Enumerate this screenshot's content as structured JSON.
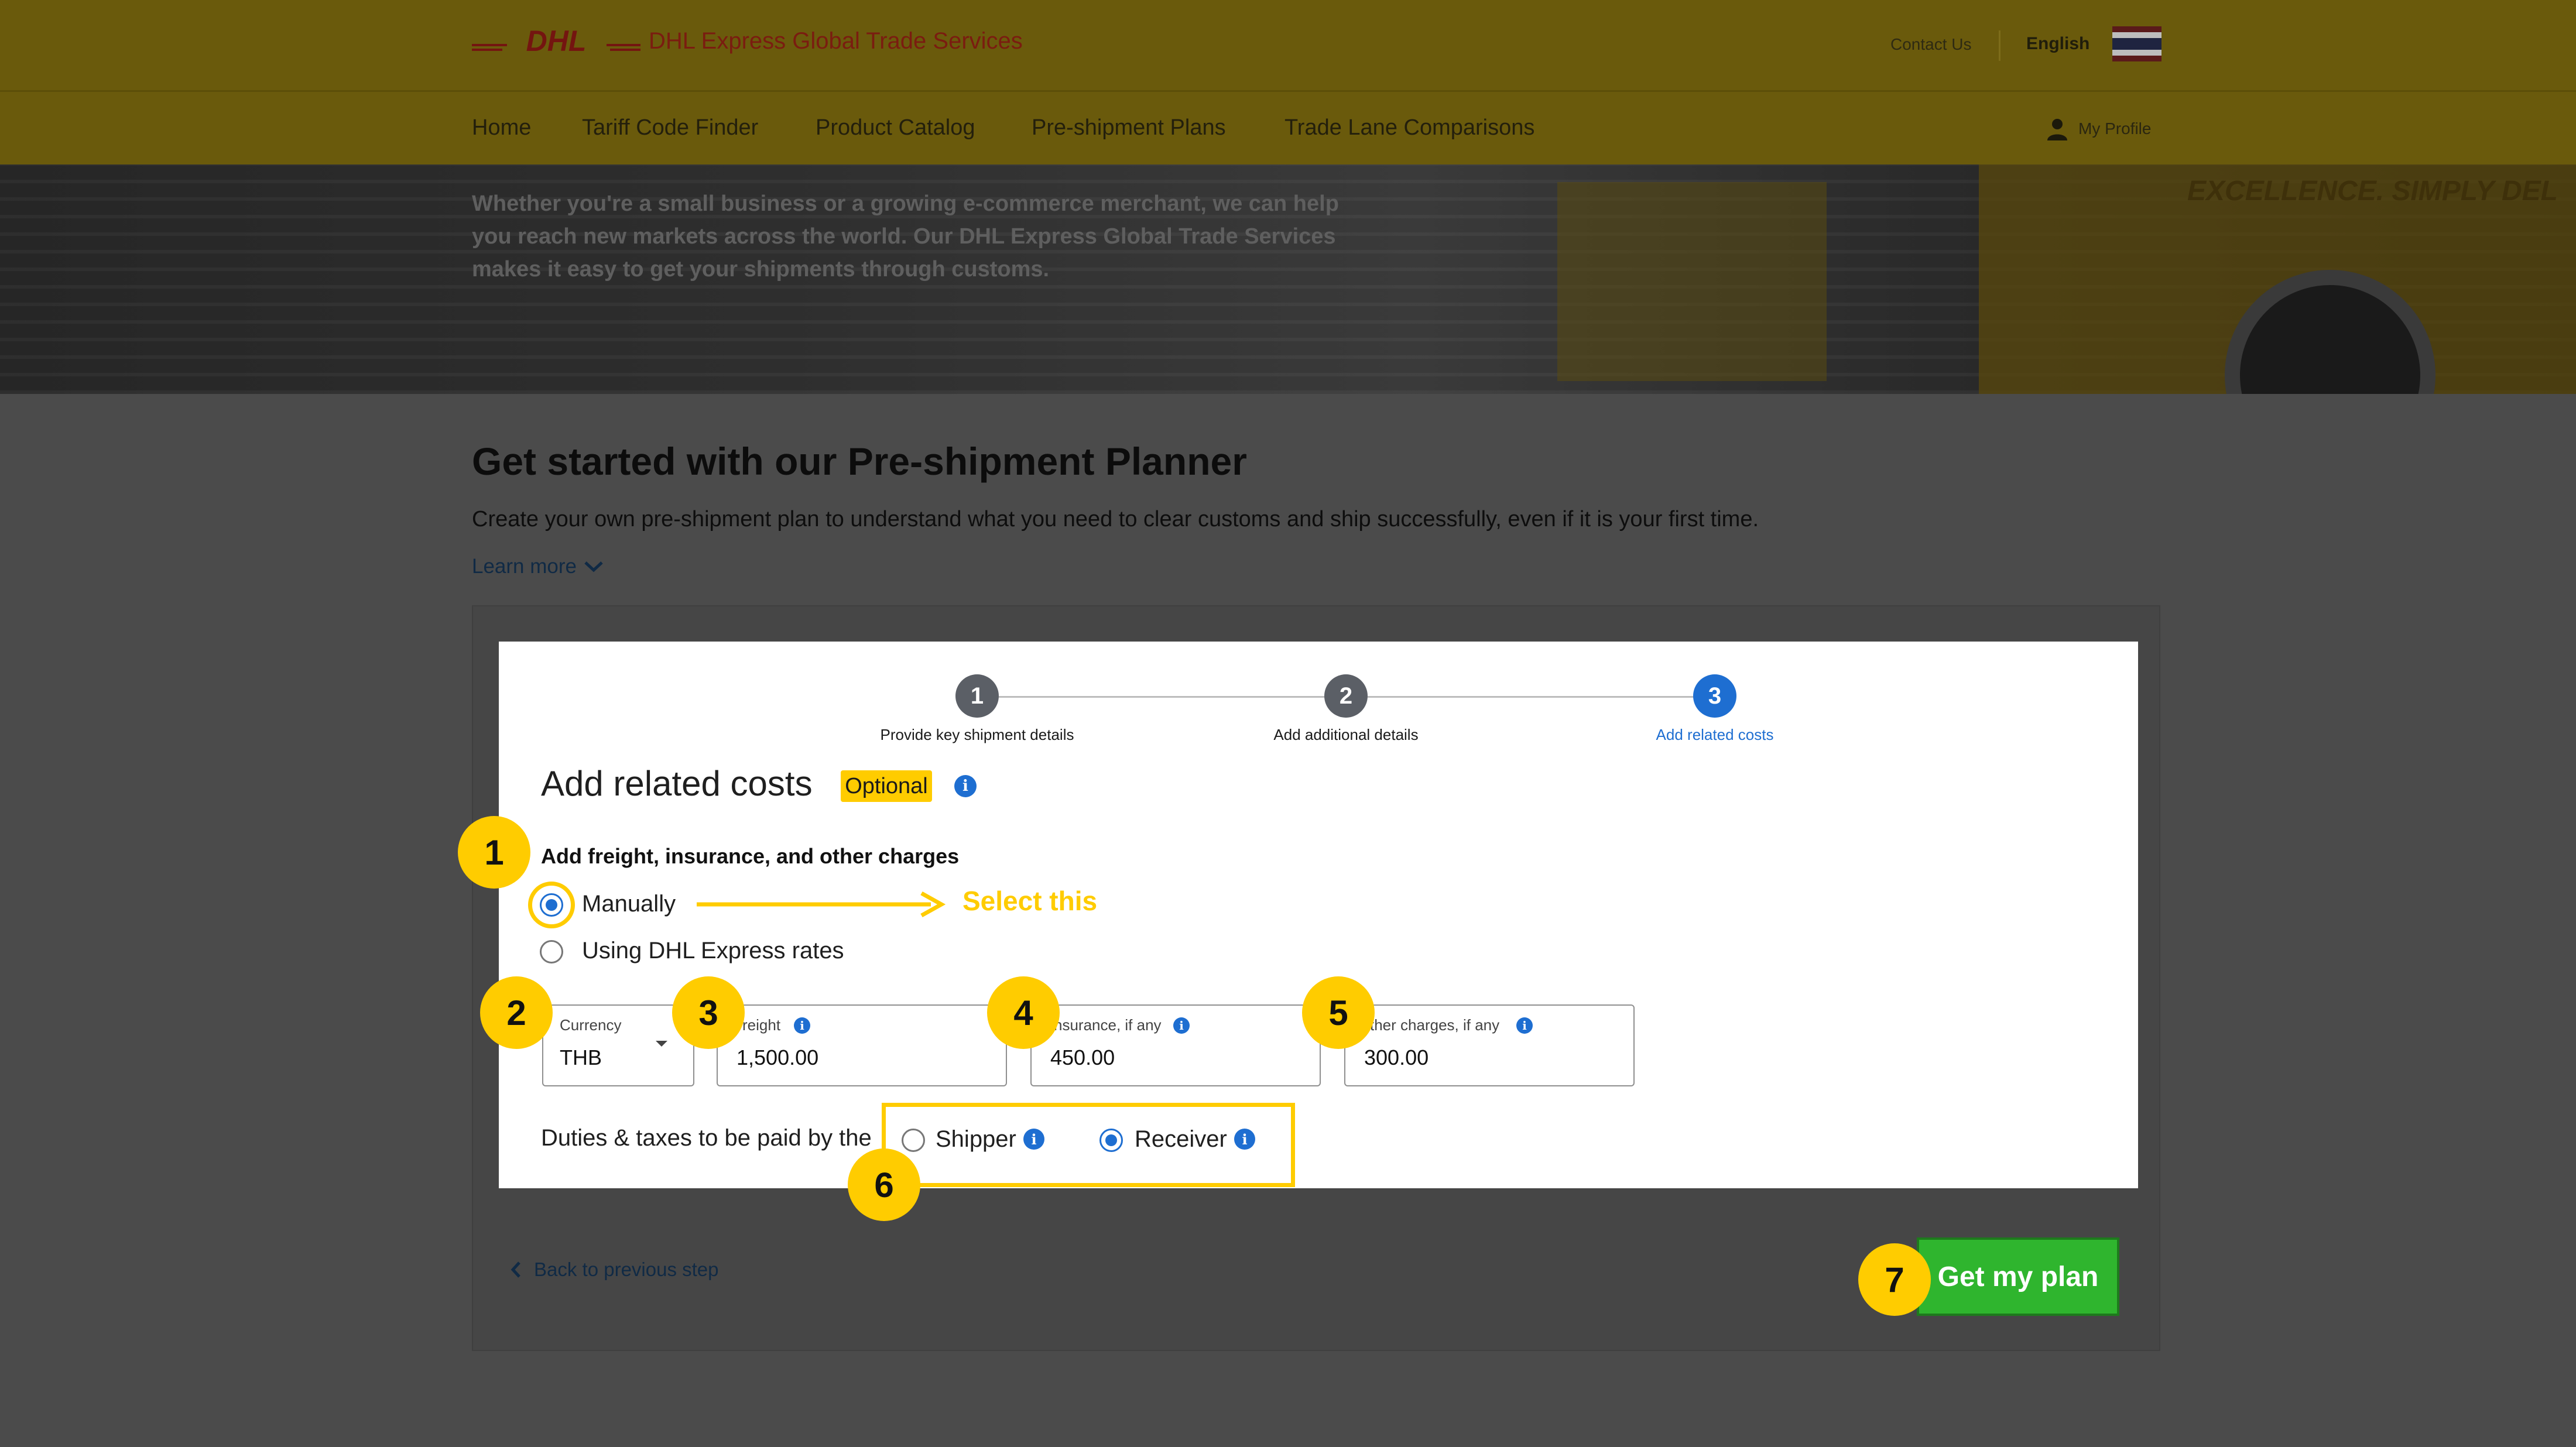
{
  "header": {
    "brand": "DHL",
    "site_title": "DHL Express Global Trade Services",
    "contact": "Contact Us",
    "language": "English",
    "flag": "thailand-flag"
  },
  "nav": {
    "items": [
      "Home",
      "Tariff Code Finder",
      "Product Catalog",
      "Pre-shipment Plans",
      "Trade Lane Comparisons"
    ],
    "profile": "My Profile"
  },
  "hero": {
    "text": "Whether you're a small business or a growing e-commerce merchant, we can help you reach new markets across the world. Our DHL Express Global Trade Services makes it easy to get your shipments through customs.",
    "watermark": "EXCELLENCE. SIMPLY DEL"
  },
  "page": {
    "title": "Get started with our Pre-shipment Planner",
    "description": "Create your own pre-shipment plan to understand what you need to clear customs and ship successfully, even if it is your first time.",
    "learn_more": "Learn more"
  },
  "stepper": {
    "steps": [
      {
        "number": "1",
        "label": "Provide key shipment details",
        "state": "complete"
      },
      {
        "number": "2",
        "label": "Add additional details",
        "state": "complete"
      },
      {
        "number": "3",
        "label": "Add related costs",
        "state": "active"
      }
    ]
  },
  "form": {
    "title": "Add related costs",
    "optional_badge": "Optional",
    "charges_label": "Add freight, insurance, and other charges",
    "options": {
      "manually": "Manually",
      "dhl_rates": "Using DHL Express rates"
    },
    "selected_option": "manually",
    "fields": {
      "currency": {
        "label": "Currency",
        "value": "THB"
      },
      "freight": {
        "label": "reight",
        "value": "1,500.00"
      },
      "insurance": {
        "label": "nsurance, if any",
        "value": "450.00"
      },
      "other": {
        "label": "ther charges, if any",
        "value": "300.00"
      }
    },
    "duties_label": "Duties & taxes to be paid by the",
    "payer": {
      "shipper": "Shipper",
      "receiver": "Receiver",
      "selected": "receiver"
    }
  },
  "actions": {
    "back": "Back to previous step",
    "submit": "Get my plan"
  },
  "annotations": {
    "badges": [
      "1",
      "2",
      "3",
      "4",
      "5",
      "6",
      "7"
    ],
    "select_hint": "Select this"
  },
  "colors": {
    "dhl_yellow": "#ffcc00",
    "dhl_red": "#d40511",
    "link_blue": "#1e6ed1",
    "step_gray": "#5b5f66",
    "button_green": "#2fb52e"
  }
}
